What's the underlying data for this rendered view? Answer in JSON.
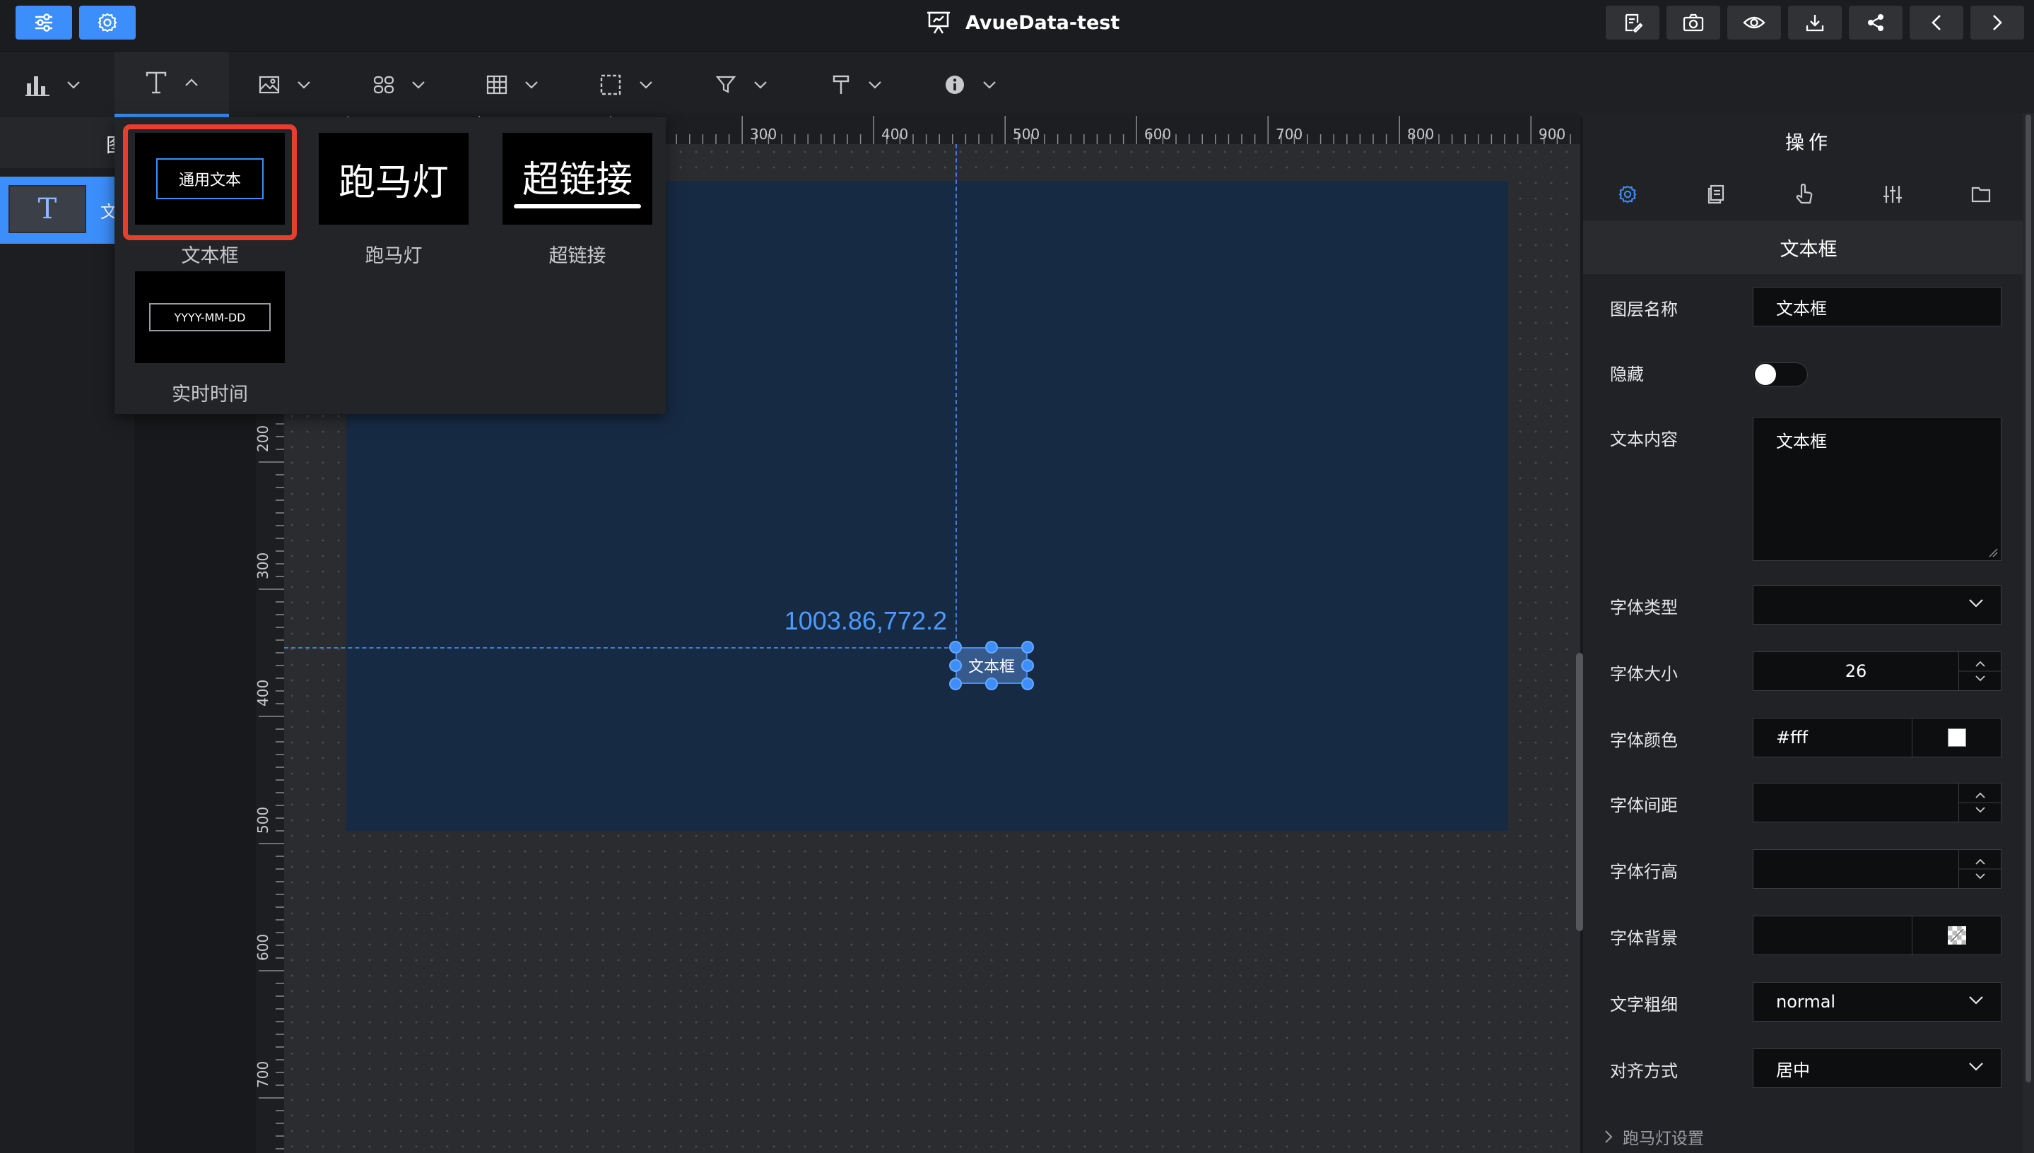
{
  "header": {
    "title": "AvueData-test"
  },
  "canvas": {
    "coordinate_label": "1003.86,772.2",
    "widget_label": "文本框"
  },
  "rulers": {
    "top_ticks": [
      "300",
      "400",
      "500",
      "600",
      "700",
      "800",
      "900"
    ],
    "left_ticks": [
      "200",
      "300",
      "400",
      "500",
      "600",
      "700"
    ]
  },
  "left_panel": {
    "header_char": "图",
    "layer_icon": "T",
    "layer_text": "文"
  },
  "text_dropdown": {
    "items": [
      {
        "label": "文本框",
        "preview": "通用文本"
      },
      {
        "label": "跑马灯",
        "preview": "跑马灯"
      },
      {
        "label": "超链接",
        "preview": "超链接"
      },
      {
        "label": "实时时间",
        "preview": "YYYY-MM-DD"
      }
    ]
  },
  "right_panel": {
    "title": "操作",
    "section_title": "文本框",
    "fields": {
      "layer_name_label": "图层名称",
      "layer_name_value": "文本框",
      "hidden_label": "隐藏",
      "content_label": "文本内容",
      "content_value": "文本框",
      "font_type_label": "字体类型",
      "font_size_label": "字体大小",
      "font_size_value": "26",
      "font_color_label": "字体颜色",
      "font_color_value": "#fff",
      "letter_spacing_label": "字体间距",
      "line_height_label": "字体行高",
      "background_label": "字体背景",
      "weight_label": "文字粗细",
      "weight_value": "normal",
      "align_label": "对齐方式",
      "align_value": "居中"
    },
    "collapse_section": "跑马灯设置"
  },
  "colors": {
    "accent": "#3c8efa",
    "canvas_screen": "#172a44",
    "highlight_frame": "#e5402d"
  }
}
